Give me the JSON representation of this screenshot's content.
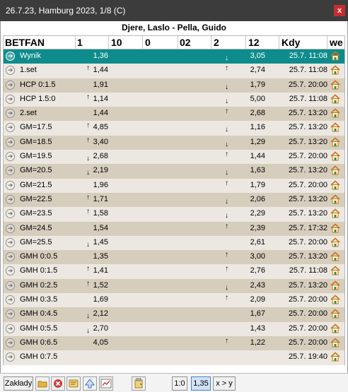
{
  "window": {
    "title": "26.7.23, Hamburg 2023, 1/8 (C)",
    "close_label": "x"
  },
  "match": "Djere, Laslo - Pella, Guido",
  "columns": {
    "betfan": "BETFAN",
    "c1": "1",
    "c10": "10",
    "c0": "0",
    "c02": "02",
    "c2": "2",
    "c12": "12",
    "kdy": "Kdy",
    "we": "we"
  },
  "rows": [
    {
      "name": "Wynik",
      "v1": "1,36",
      "a1": "",
      "v2": "3,05",
      "a2": "down",
      "kdy": "25.7. 11:08",
      "selected": true
    },
    {
      "name": "1.set",
      "v1": "1,44",
      "a1": "up",
      "v2": "2,74",
      "a2": "up",
      "kdy": "25.7. 11:08"
    },
    {
      "name": "HCP 0:1.5",
      "v1": "1,91",
      "a1": "",
      "v2": "1,79",
      "a2": "down",
      "kdy": "25.7. 20:00"
    },
    {
      "name": "HCP 1.5:0",
      "v1": "1,14",
      "a1": "up",
      "v2": "5,00",
      "a2": "down",
      "kdy": "25.7. 11:08"
    },
    {
      "name": "2.set",
      "v1": "1,44",
      "a1": "",
      "v2": "2,68",
      "a2": "up",
      "kdy": "25.7. 13:20"
    },
    {
      "name": "GM=17.5",
      "v1": "4,85",
      "a1": "up",
      "v2": "1,16",
      "a2": "down",
      "kdy": "25.7. 13:20"
    },
    {
      "name": "GM=18.5",
      "v1": "3,40",
      "a1": "up",
      "v2": "1,29",
      "a2": "down",
      "kdy": "25.7. 13:20"
    },
    {
      "name": "GM=19.5",
      "v1": "2,68",
      "a1": "down",
      "v2": "1,44",
      "a2": "up",
      "kdy": "25.7. 20:00"
    },
    {
      "name": "GM=20.5",
      "v1": "2,19",
      "a1": "down",
      "v2": "1,63",
      "a2": "down",
      "kdy": "25.7. 13:20"
    },
    {
      "name": "GM=21.5",
      "v1": "1,96",
      "a1": "",
      "v2": "1,79",
      "a2": "up",
      "kdy": "25.7. 20:00"
    },
    {
      "name": "GM=22.5",
      "v1": "1,71",
      "a1": "up",
      "v2": "2,06",
      "a2": "down",
      "kdy": "25.7. 13:20"
    },
    {
      "name": "GM=23.5",
      "v1": "1,58",
      "a1": "up",
      "v2": "2,29",
      "a2": "down",
      "kdy": "25.7. 13:20"
    },
    {
      "name": "GM=24.5",
      "v1": "1,54",
      "a1": "",
      "v2": "2,39",
      "a2": "up",
      "kdy": "25.7. 17:32"
    },
    {
      "name": "GM=25.5",
      "v1": "1,45",
      "a1": "down",
      "v2": "2,61",
      "a2": "",
      "kdy": "25.7. 20:00"
    },
    {
      "name": "GMH 0:0.5",
      "v1": "1,35",
      "a1": "",
      "v2": "3,00",
      "a2": "up",
      "kdy": "25.7. 13:20"
    },
    {
      "name": "GMH 0:1.5",
      "v1": "1,41",
      "a1": "up",
      "v2": "2,76",
      "a2": "up",
      "kdy": "25.7. 11:08"
    },
    {
      "name": "GMH 0:2.5",
      "v1": "1,52",
      "a1": "up",
      "v2": "2,43",
      "a2": "down",
      "kdy": "25.7. 13:20"
    },
    {
      "name": "GMH 0:3.5",
      "v1": "1,69",
      "a1": "",
      "v2": "2,09",
      "a2": "up",
      "kdy": "25.7. 20:00"
    },
    {
      "name": "GMH 0:4.5",
      "v1": "2,12",
      "a1": "down",
      "v2": "1,67",
      "a2": "",
      "kdy": "25.7. 20:00"
    },
    {
      "name": "GMH 0:5.5",
      "v1": "2,70",
      "a1": "down",
      "v2": "1,43",
      "a2": "",
      "kdy": "25.7. 20:00"
    },
    {
      "name": "GMH 0:6.5",
      "v1": "4,05",
      "a1": "",
      "v2": "1,22",
      "a2": "up",
      "kdy": "25.7. 20:00"
    },
    {
      "name": "GMH 0:7.5",
      "v1": "",
      "a1": "",
      "v2": "",
      "a2": "",
      "kdy": "25.7. 19:40"
    }
  ],
  "toolbar": {
    "zaklady_label": "Zakłady",
    "ratio_label": "1:0",
    "odds_label": "1,35",
    "xy_label": "x > y"
  },
  "colors": {
    "selected_row": "#0e8c8c",
    "row_light": "#ece8e1",
    "row_dark": "#d6cdbd",
    "titlebar": "#3c3c3c",
    "close_button": "#c62e2e"
  },
  "icons": {
    "row_circle": "circle-arrow-right-icon",
    "row_home": "home-icon",
    "arrow_up": "↑",
    "arrow_down": "↓"
  }
}
